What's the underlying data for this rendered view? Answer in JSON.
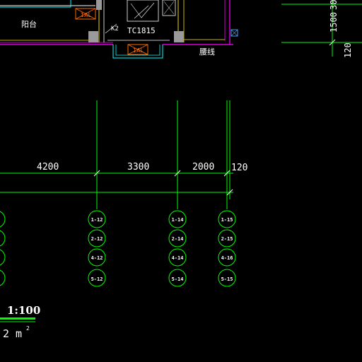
{
  "drawing": {
    "rooms": {
      "balcony": "阳台",
      "waistline": "腰线"
    },
    "window_tag": "TC1815",
    "door_tag": "K2",
    "hidden_box_label": "1AL",
    "right_dims": {
      "top": "1500",
      "top_partial": "30",
      "bottom": "120"
    },
    "dimension_labels": [
      "4200",
      "3300",
      "2000",
      "120"
    ],
    "axis_labels": {
      "col1": [
        "1-12",
        "2-12",
        "4-12",
        "5-12"
      ],
      "col2": [
        "1-14",
        "2-14",
        "4-14",
        "5-14"
      ],
      "col3": [
        "1-15",
        "2-15",
        "4-16",
        "5-15"
      ]
    },
    "scale_text": "1:100",
    "area_text": "2 m",
    "area_sup": "2"
  }
}
